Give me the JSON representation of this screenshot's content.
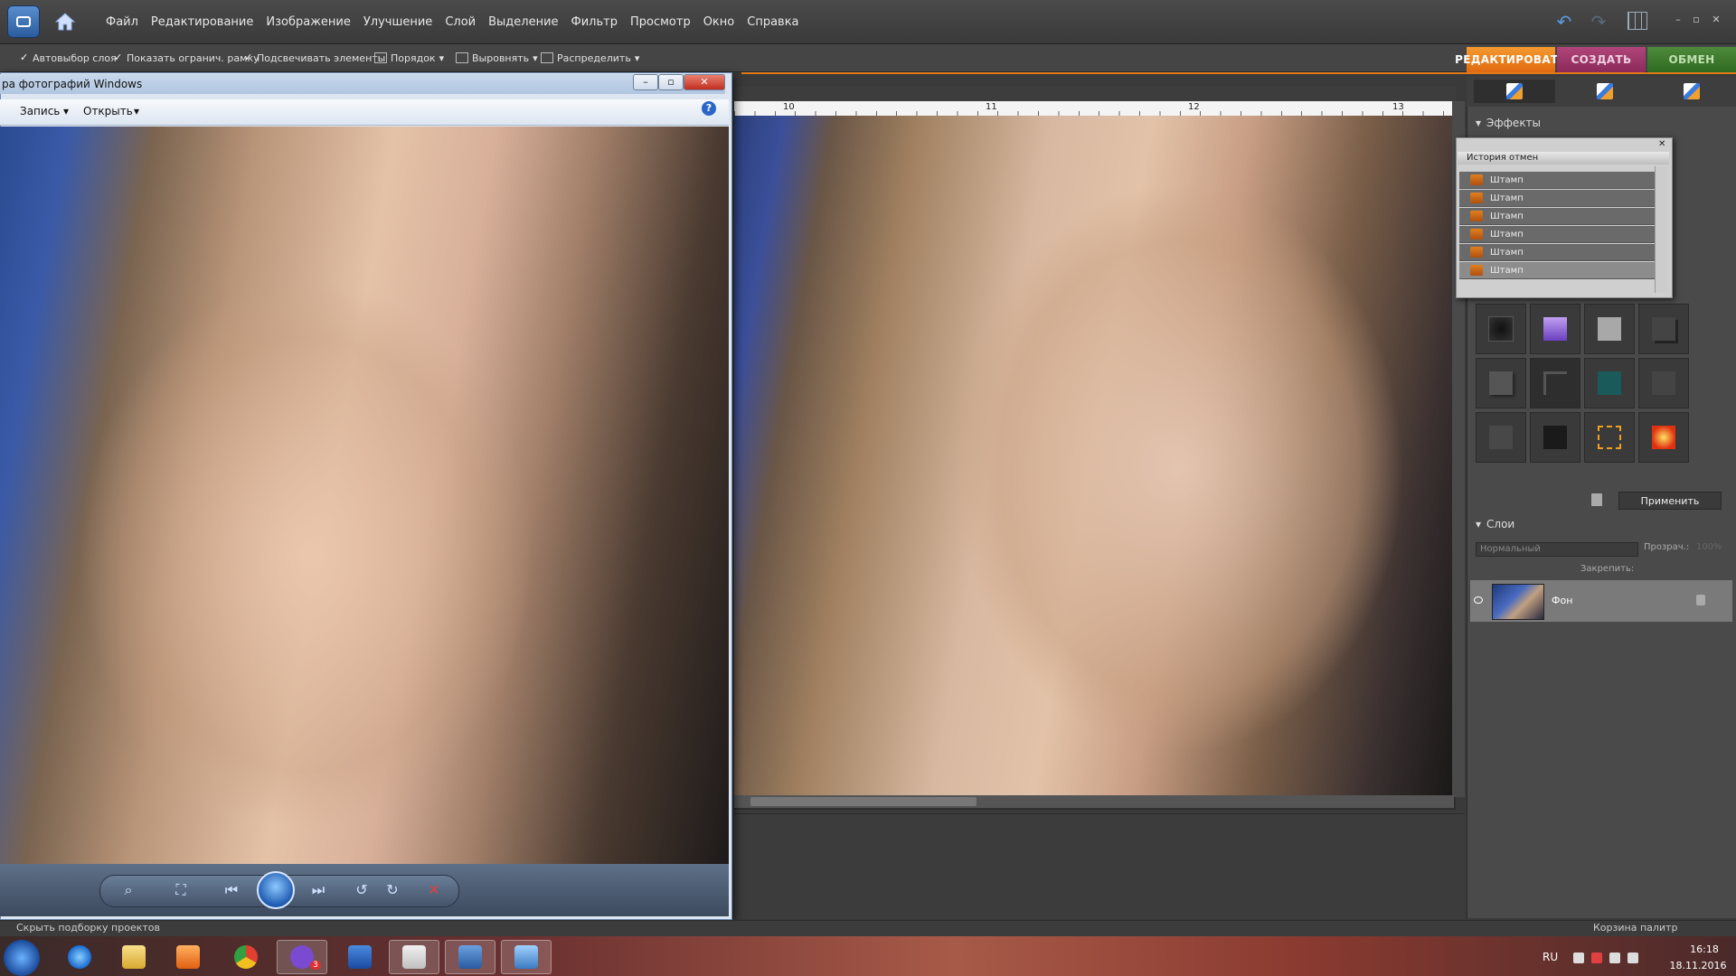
{
  "menubar": {
    "items": [
      "Файл",
      "Редактирование",
      "Изображение",
      "Улучшение",
      "Слой",
      "Выделение",
      "Фильтр",
      "Просмотр",
      "Окно",
      "Справка"
    ]
  },
  "options": {
    "auto_select": "Автовыбор слоя",
    "show_bounds": "Показать огранич. рамку",
    "highlight": "Подсвечивать элементы",
    "order": "Порядок",
    "align": "Выровнять",
    "distribute": "Распределить"
  },
  "mode_tabs": {
    "edit": "РЕДАКТИРОВАТЬ",
    "create": "СОЗДАТЬ",
    "share": "ОБМЕН"
  },
  "ruler": [
    "10",
    "11",
    "12",
    "13"
  ],
  "panels": {
    "effects": "Эффекты",
    "history_title": "История отмен",
    "history_items": [
      "Штамп",
      "Штамп",
      "Штамп",
      "Штамп",
      "Штамп",
      "Штамп"
    ],
    "apply": "Применить",
    "layers": "Слои",
    "blend_mode": "Нормальный",
    "opacity_label": "Прозрач.:",
    "opacity_value": "100%",
    "lock_label": "Закрепить:",
    "layer_name": "Фон"
  },
  "viewer": {
    "title": "ра фотографий Windows",
    "menu_record": "Запись",
    "menu_open": "Открыть",
    "help": "?"
  },
  "statusbar": {
    "left": "Скрыть подборку проектов",
    "right": "Корзина палитр"
  },
  "taskbar": {
    "lang": "RU",
    "time": "16:18",
    "date": "18.11.2016",
    "viber_badge": "3"
  },
  "colors": {
    "edit_tab": "#e8781a",
    "create_tab": "#9a3468",
    "share_tab": "#3f7a2e",
    "accent_line": "#e07a18"
  }
}
